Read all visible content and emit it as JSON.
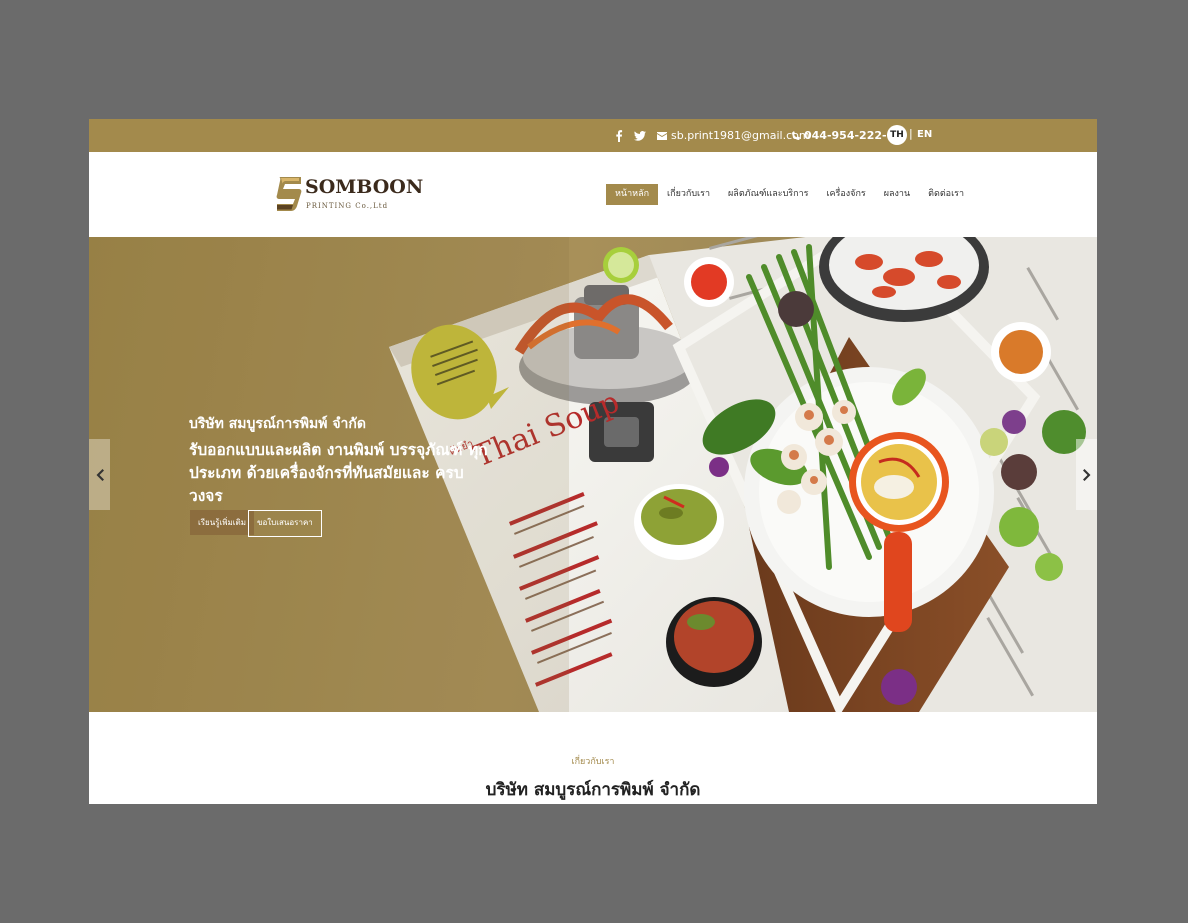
{
  "topbar": {
    "email": "sb.print1981@gmail.com",
    "phone": "044-954-222-6",
    "lang_th": "TH",
    "lang_sep": "|",
    "lang_en": "EN"
  },
  "logo": {
    "name": "SOMBOON",
    "sub": "PRINTING Co.,Ltd"
  },
  "nav": {
    "items": [
      "หน้าหลัก",
      "เกี่ยวกับเรา",
      "ผลิตภัณฑ์และบริการ",
      "เครื่องจักร",
      "ผลงาน",
      "ติดต่อเรา"
    ],
    "active_index": 0
  },
  "hero": {
    "company": "บริษัท สมบูรณ์การพิมพ์ จำกัด",
    "headline": "รับออกแบบและผลิต งานพิมพ์ บรรจุภัณฑ์ ทุกประเภท ด้วยเครื่องจักรที่ทันสมัยและ ครบวงจร",
    "btn_primary": "เรียนรู้เพิ่มเติม",
    "btn_outline": "ขอใบเสนอราคา",
    "magazine_title": "Thai Soup",
    "magazine_caption": "ต้มยำ"
  },
  "about": {
    "label": "เกี่ยวกับเรา",
    "title": "บริษัท สมบูรณ์การพิมพ์ จำกัด"
  },
  "colors": {
    "brand_gold": "#a38a4c",
    "button_brown": "#8c6d3e",
    "frame_gray": "#6b6b6b"
  },
  "icons": [
    "facebook-icon",
    "twitter-icon",
    "envelope-icon",
    "phone-icon",
    "chevron-left-icon",
    "chevron-right-icon"
  ]
}
